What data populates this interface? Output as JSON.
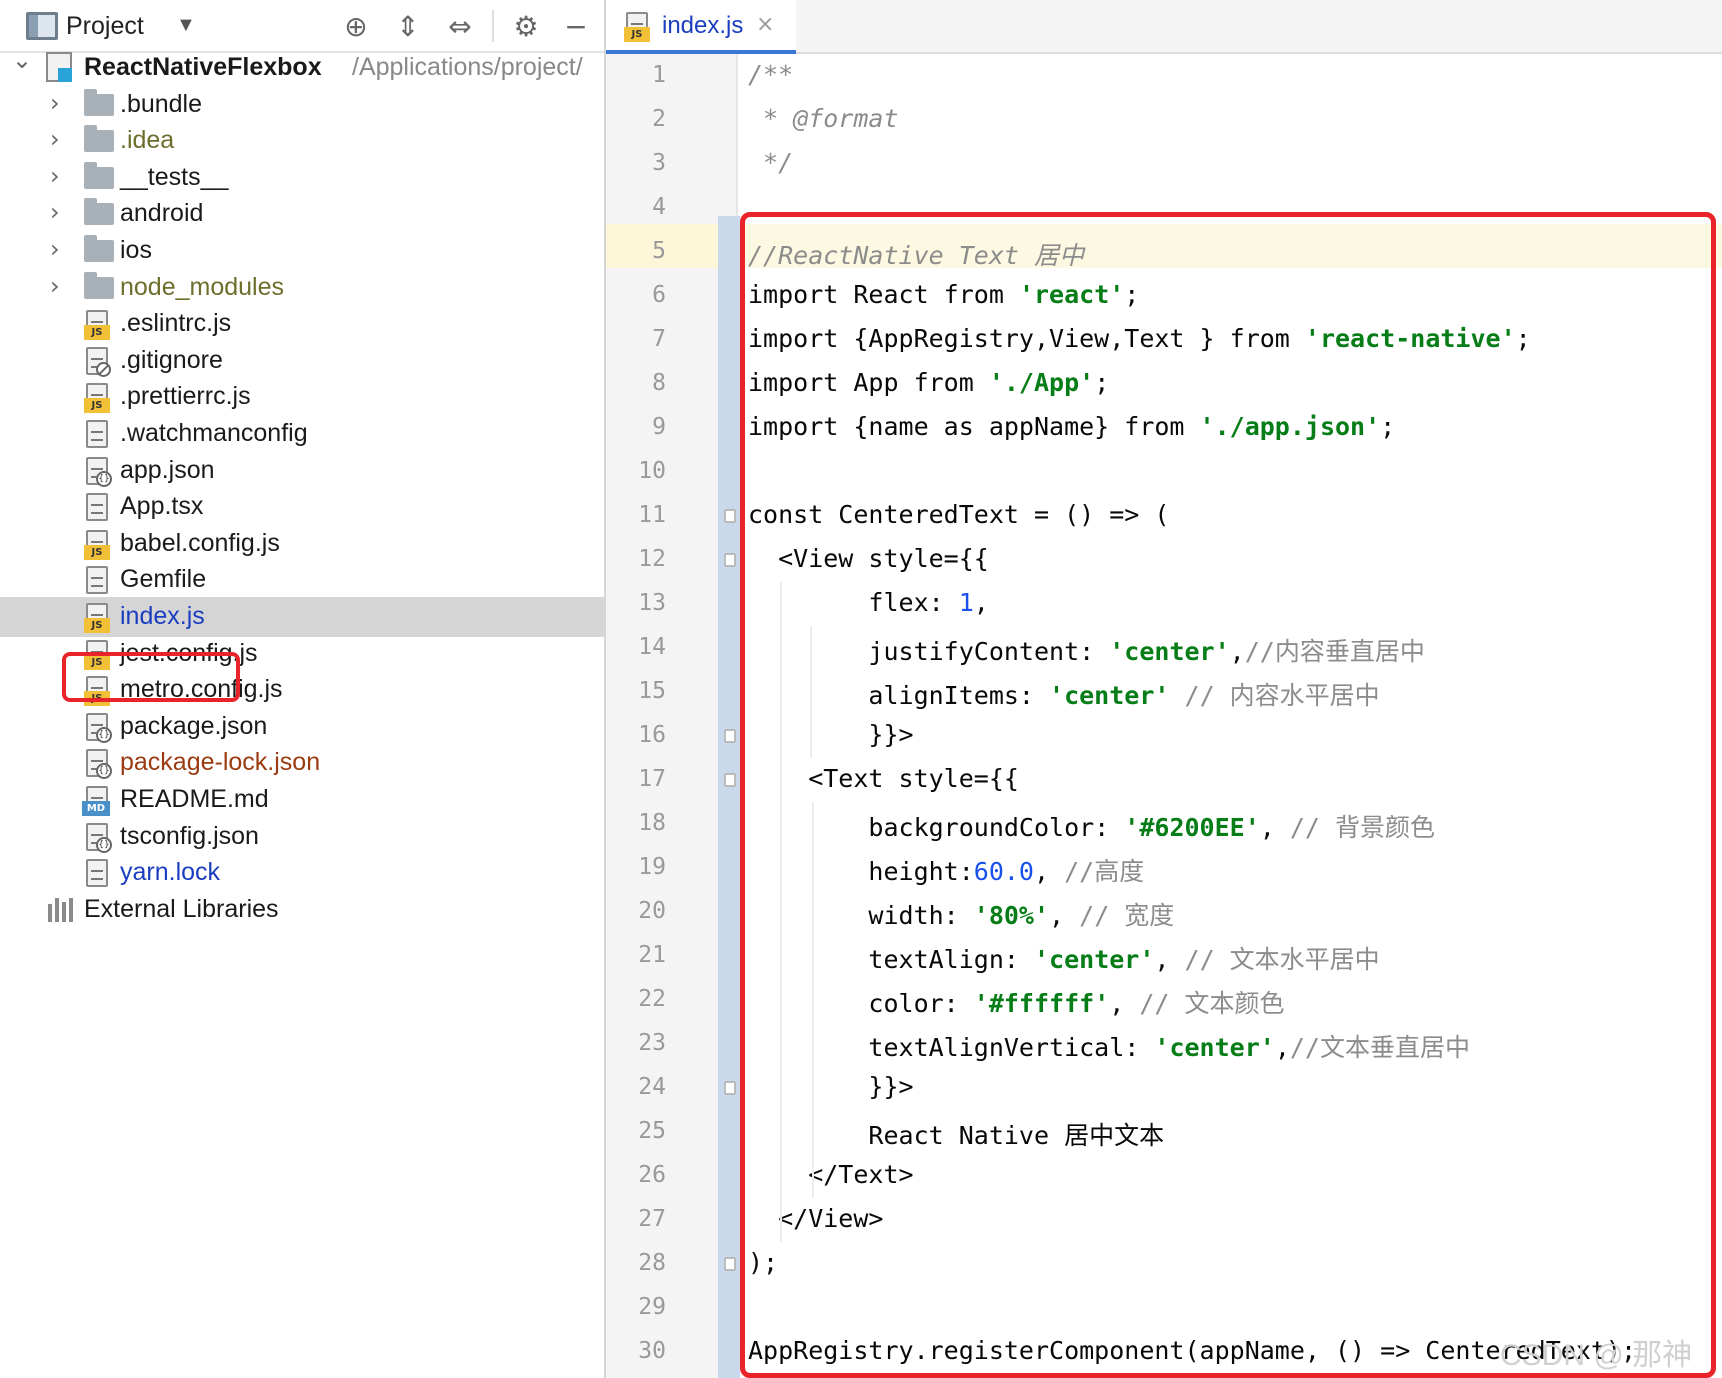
{
  "project_panel": {
    "title": "Project",
    "root": {
      "name": "ReactNativeFlexbox",
      "path": "/Applications/project/"
    },
    "folders": [
      {
        "label": ".bundle",
        "style": "normal"
      },
      {
        "label": ".idea",
        "style": "olive"
      },
      {
        "label": "__tests__",
        "style": "normal"
      },
      {
        "label": "android",
        "style": "normal"
      },
      {
        "label": "ios",
        "style": "normal"
      },
      {
        "label": "node_modules",
        "style": "olive"
      }
    ],
    "files": [
      {
        "label": ".eslintrc.js",
        "icon": "js-file-icon",
        "style": "normal"
      },
      {
        "label": ".gitignore",
        "icon": "ignore-file-icon",
        "style": "normal"
      },
      {
        "label": ".prettierrc.js",
        "icon": "js-file-icon",
        "style": "normal"
      },
      {
        "label": ".watchmanconfig",
        "icon": "text-file-icon",
        "style": "normal"
      },
      {
        "label": "app.json",
        "icon": "json-file-icon",
        "style": "normal"
      },
      {
        "label": "App.tsx",
        "icon": "text-file-icon",
        "style": "normal"
      },
      {
        "label": "babel.config.js",
        "icon": "js-file-icon",
        "style": "normal"
      },
      {
        "label": "Gemfile",
        "icon": "text-file-icon",
        "style": "normal"
      },
      {
        "label": "index.js",
        "icon": "js-file-icon",
        "style": "blue"
      },
      {
        "label": "jest.config.js",
        "icon": "js-file-icon",
        "style": "normal"
      },
      {
        "label": "metro.config.js",
        "icon": "js-file-icon",
        "style": "normal"
      },
      {
        "label": "package.json",
        "icon": "json-file-icon",
        "style": "normal"
      },
      {
        "label": "package-lock.json",
        "icon": "json-file-icon",
        "style": "brown"
      },
      {
        "label": "README.md",
        "icon": "md-file-icon",
        "style": "normal"
      },
      {
        "label": "tsconfig.json",
        "icon": "json-file-icon",
        "style": "normal"
      },
      {
        "label": "yarn.lock",
        "icon": "text-file-icon",
        "style": "blue"
      }
    ],
    "external_libraries": "External Libraries"
  },
  "editor": {
    "tab": {
      "label": "index.js",
      "close": "×",
      "badge": "JS"
    },
    "line_numbers": [
      "1",
      "2",
      "3",
      "4",
      "5",
      "6",
      "7",
      "8",
      "9",
      "10",
      "11",
      "12",
      "13",
      "14",
      "15",
      "16",
      "17",
      "18",
      "19",
      "20",
      "21",
      "22",
      "23",
      "24",
      "25",
      "26",
      "27",
      "28",
      "29",
      "30"
    ],
    "lines": [
      [
        [
          "cm",
          "/**"
        ]
      ],
      [
        [
          "cm",
          " * @format"
        ]
      ],
      [
        [
          "cm",
          " */"
        ]
      ],
      [],
      [
        [
          "cm",
          "//ReactNative Text 居中"
        ]
      ],
      [
        [
          "pl",
          "import React from "
        ],
        [
          "str",
          "'react'"
        ],
        [
          "pl",
          ";"
        ]
      ],
      [
        [
          "pl",
          "import {AppRegistry,View,Text } from "
        ],
        [
          "str",
          "'react-native'"
        ],
        [
          "pl",
          ";"
        ]
      ],
      [
        [
          "pl",
          "import App from "
        ],
        [
          "str",
          "'./App'"
        ],
        [
          "pl",
          ";"
        ]
      ],
      [
        [
          "pl",
          "import {name as appName} from "
        ],
        [
          "str",
          "'./app.json'"
        ],
        [
          "pl",
          ";"
        ]
      ],
      [],
      [
        [
          "pl",
          "const CenteredText = () => ("
        ]
      ],
      [
        [
          "pl",
          "  <View style={{"
        ]
      ],
      [
        [
          "pl",
          "        flex: "
        ],
        [
          "num",
          "1"
        ],
        [
          "pl",
          ","
        ]
      ],
      [
        [
          "pl",
          "        justifyContent: "
        ],
        [
          "str",
          "'center'"
        ],
        [
          "pl",
          ","
        ],
        [
          "cm2",
          "//内容垂直居中"
        ]
      ],
      [
        [
          "pl",
          "        alignItems: "
        ],
        [
          "str",
          "'center'"
        ],
        [
          "pl",
          " "
        ],
        [
          "cm2",
          "// 内容水平居中"
        ]
      ],
      [
        [
          "pl",
          "        }}>"
        ]
      ],
      [
        [
          "pl",
          "    <Text style={{"
        ]
      ],
      [
        [
          "pl",
          "        backgroundColor: "
        ],
        [
          "str",
          "'#6200EE'"
        ],
        [
          "pl",
          ", "
        ],
        [
          "cm2",
          "// 背景颜色"
        ]
      ],
      [
        [
          "pl",
          "        height:"
        ],
        [
          "num",
          "60.0"
        ],
        [
          "pl",
          ", "
        ],
        [
          "cm2",
          "//高度"
        ]
      ],
      [
        [
          "pl",
          "        width: "
        ],
        [
          "str",
          "'80%'"
        ],
        [
          "pl",
          ", "
        ],
        [
          "cm2",
          "// 宽度"
        ]
      ],
      [
        [
          "pl",
          "        textAlign: "
        ],
        [
          "str",
          "'center'"
        ],
        [
          "pl",
          ", "
        ],
        [
          "cm2",
          "// 文本水平居中"
        ]
      ],
      [
        [
          "pl",
          "        color: "
        ],
        [
          "str",
          "'#ffffff'"
        ],
        [
          "pl",
          ", "
        ],
        [
          "cm2",
          "// 文本颜色"
        ]
      ],
      [
        [
          "pl",
          "        textAlignVertical: "
        ],
        [
          "str",
          "'center'"
        ],
        [
          "pl",
          ","
        ],
        [
          "cm2",
          "//文本垂直居中"
        ]
      ],
      [
        [
          "pl",
          "        }}>"
        ]
      ],
      [
        [
          "pl",
          "        React Native 居中文本"
        ]
      ],
      [
        [
          "pl",
          "    </Text>"
        ]
      ],
      [
        [
          "pl",
          "  </View>"
        ]
      ],
      [
        [
          "pl",
          ");"
        ]
      ],
      [],
      [
        [
          "pl",
          "AppRegistry.registerComponent(appName, () => CenteredText);"
        ]
      ]
    ]
  },
  "watermark": "CSDN @ 那神",
  "colors": {
    "highlight_red": "#e8232a",
    "string_green": "#067d17",
    "number_blue": "#1750eb",
    "comment_gray": "#8c8c8c",
    "selected_blue": "#1b3ec0"
  }
}
